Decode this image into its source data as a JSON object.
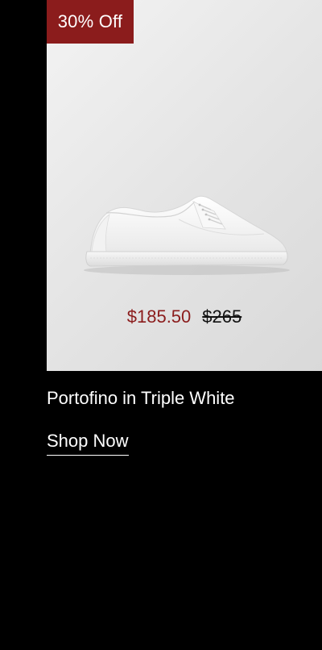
{
  "badge": {
    "label": "30% Off"
  },
  "product": {
    "price_sale": "$185.50",
    "price_original": "$265",
    "name": "Portofino in Triple White",
    "cta_label": "Shop Now"
  },
  "colors": {
    "background": "#000000",
    "accent": "#8b1c1c",
    "text": "#ffffff"
  }
}
